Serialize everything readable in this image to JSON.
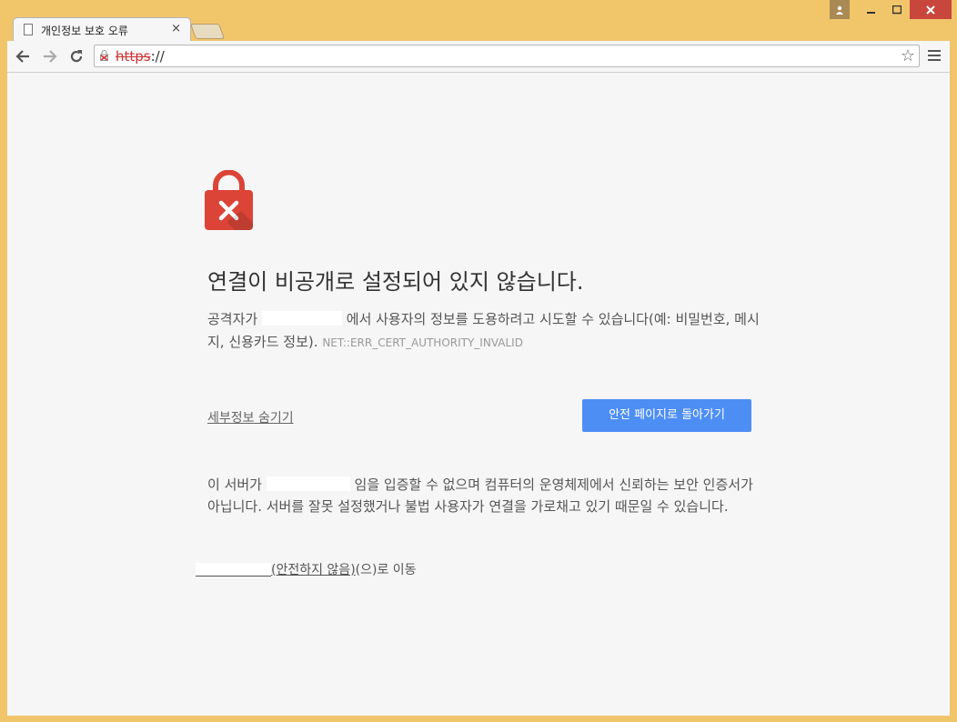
{
  "tab": {
    "title": "개인정보 보호 오류",
    "close_glyph": "×"
  },
  "toolbar": {
    "url_scheme": "https",
    "url_rest": "://"
  },
  "error": {
    "heading": "연결이 비공개로 설정되어 있지 않습니다.",
    "para1_prefix": "공격자가",
    "para1_middle": "에서 사용자의 정보를 도용하려고 시도할 수 있습니다(예: 비밀번호, 메시지, 신용카드 정보).",
    "error_code": "NET::ERR_CERT_AUTHORITY_INVALID",
    "details_link": "세부정보 숨기기",
    "back_button": "안전 페이지로 돌아가기",
    "para2_prefix": "이 서버가",
    "para2_rest": "임을 입증할 수 없으며 컴퓨터의 운영체제에서 신뢰하는 보안 인증서가 아닙니다. 서버를 잘못 설정했거나 불법 사용자가 연결을 가로채고 있기 때문일 수 있습니다.",
    "proceed_link": "(안전하지 않음)",
    "proceed_suffix": "(으)로 이동"
  },
  "icons": {
    "lock": "lock-error-icon",
    "back": "back-arrow-icon",
    "forward": "forward-arrow-icon",
    "reload": "reload-icon",
    "star": "star-icon",
    "menu": "menu-icon"
  },
  "colors": {
    "frame": "#f1c56a",
    "lock_red": "#db4437",
    "button_blue": "#4d8ef5",
    "close_red": "#c9463d"
  }
}
